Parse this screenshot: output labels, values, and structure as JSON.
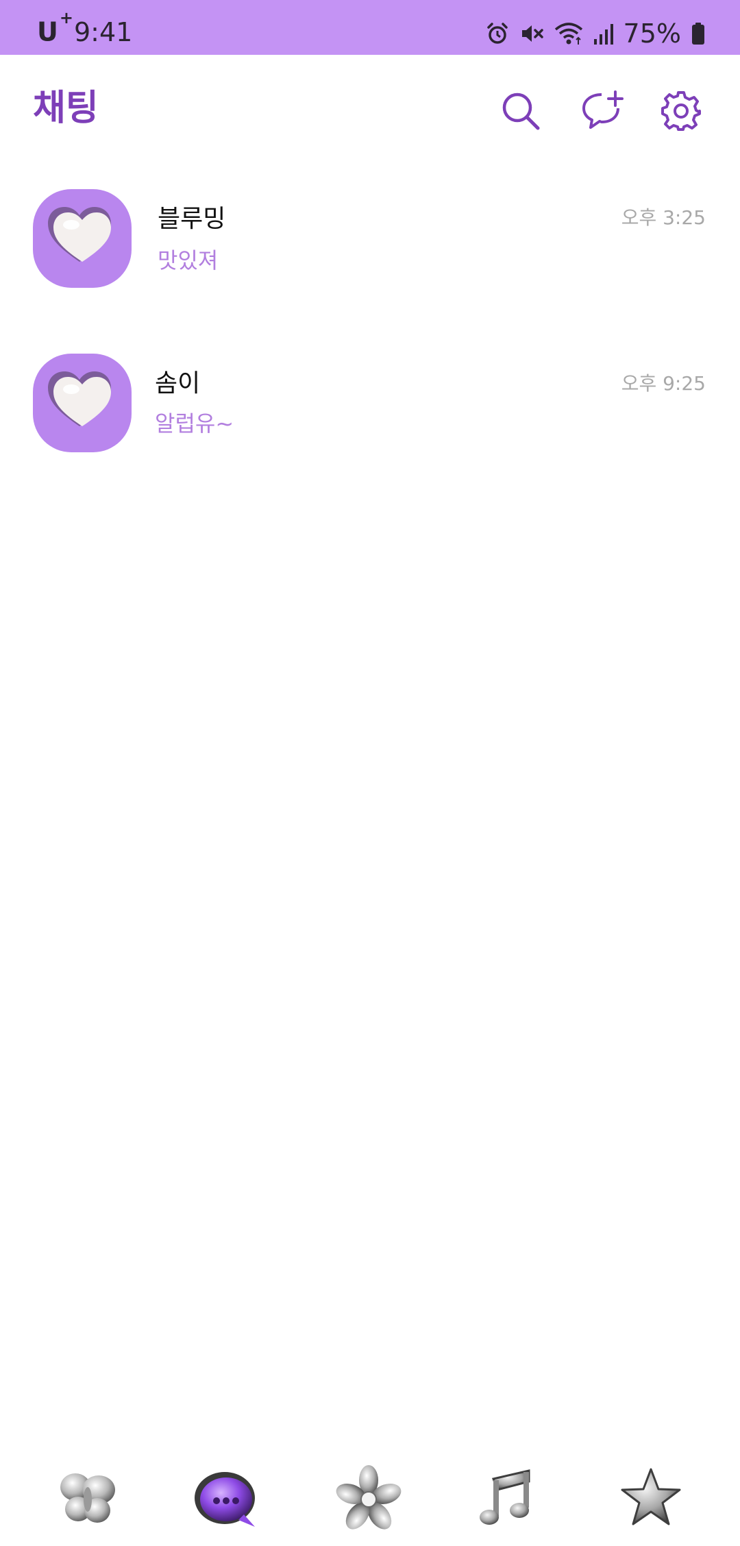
{
  "status_bar": {
    "carrier": "U",
    "carrier_sup": "+",
    "time": "9:41",
    "battery": "75%",
    "background_color": "#c493f4",
    "icons": [
      "alarm-icon",
      "mute-icon",
      "wifi-icon",
      "signal-icon",
      "battery-icon"
    ]
  },
  "header": {
    "title": "채팅",
    "title_color": "#7d3fb8",
    "actions": [
      "search-icon",
      "new-chat-icon",
      "settings-icon"
    ]
  },
  "chats": [
    {
      "name": "블루밍",
      "preview": "맛있져",
      "time": "오후 3:25",
      "avatar_icon": "heart-icon"
    },
    {
      "name": "솜이",
      "preview": "알럽유~",
      "time": "오후 9:25",
      "avatar_icon": "heart-icon"
    }
  ],
  "bottom_nav": {
    "items": [
      {
        "icon": "butterfly-icon",
        "active": false
      },
      {
        "icon": "chat-bubble-icon",
        "active": true
      },
      {
        "icon": "flower-icon",
        "active": false
      },
      {
        "icon": "music-note-icon",
        "active": false
      },
      {
        "icon": "star-icon",
        "active": false
      }
    ]
  },
  "colors": {
    "accent": "#7d3fb8",
    "avatar_bg": "#b986ee",
    "preview_text": "#b27fdf",
    "time_text": "#a8a8a8"
  }
}
